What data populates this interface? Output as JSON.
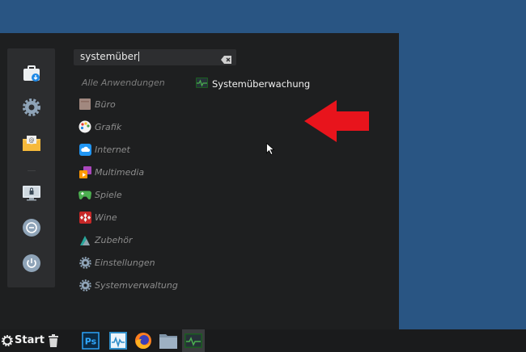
{
  "menu": {
    "search": {
      "value": "systemüber"
    },
    "all_apps_label": "Alle Anwendungen",
    "categories": [
      {
        "label": "Büro",
        "icon": "office-icon"
      },
      {
        "label": "Grafik",
        "icon": "graphics-palette-icon"
      },
      {
        "label": "Internet",
        "icon": "internet-cloud-icon"
      },
      {
        "label": "Multimedia",
        "icon": "multimedia-icon"
      },
      {
        "label": "Spiele",
        "icon": "gamepad-icon"
      },
      {
        "label": "Wine",
        "icon": "wine-icon"
      },
      {
        "label": "Zubehör",
        "icon": "accessories-icon"
      },
      {
        "label": "Einstellungen",
        "icon": "settings-gear-icon"
      },
      {
        "label": "Systemverwaltung",
        "icon": "system-gear-icon"
      }
    ],
    "result": {
      "label": "Systemüberwachung",
      "icon": "system-monitor-icon"
    },
    "favorites": [
      "software-center-icon",
      "settings-icon",
      "mail-icon",
      "lock-screen-icon",
      "logout-icon",
      "power-icon"
    ]
  },
  "taskbar": {
    "start_label": "Start",
    "apps": [
      "trash-icon",
      "photoshop-icon",
      "monitor-app-icon",
      "firefox-icon",
      "files-icon",
      "system-monitor-icon"
    ]
  },
  "colors": {
    "desktop": "#295583",
    "menu_bg": "#1e1f20",
    "annotation_arrow": "#e8141c"
  }
}
